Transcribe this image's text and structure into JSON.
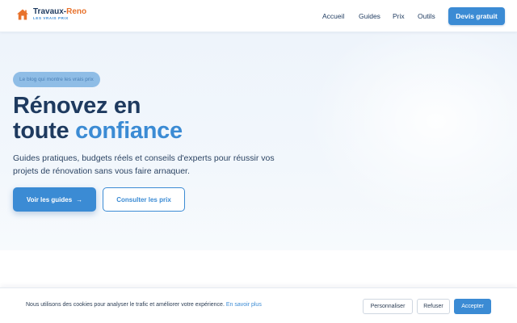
{
  "header": {
    "logo": {
      "name_part1": "Travaux-",
      "name_part2": "Reno",
      "tagline": "LES VRAIS PRIX",
      "icon": "house-icon"
    },
    "nav": [
      {
        "label": "Accueil"
      },
      {
        "label": "Guides"
      },
      {
        "label": "Prix"
      },
      {
        "label": "Outils"
      }
    ],
    "cta_label": "Devis gratuit"
  },
  "hero": {
    "badge": "Le blog qui montre les vrais prix",
    "title_line1": "Rénovez en",
    "title_line2_plain": "toute ",
    "title_line2_highlight": "confiance",
    "lead": "Guides pratiques, budgets réels et conseils d'experts pour réussir vos projets de rénovation sans vous faire arnaquer.",
    "primary_button": "Voir les guides",
    "primary_button_icon": "arrow-right-icon",
    "secondary_button": "Consulter les prix"
  },
  "cookie_banner": {
    "text": "Nous utilisons des cookies pour analyser le trafic et améliorer votre expérience.",
    "link": "En savoir plus",
    "customize": "Personnaliser",
    "refuse": "Refuser",
    "accept": "Accepter"
  },
  "colors": {
    "primary": "#3b8bd4",
    "navy": "#1e3a5f",
    "logo_accent": "#e8722c"
  }
}
